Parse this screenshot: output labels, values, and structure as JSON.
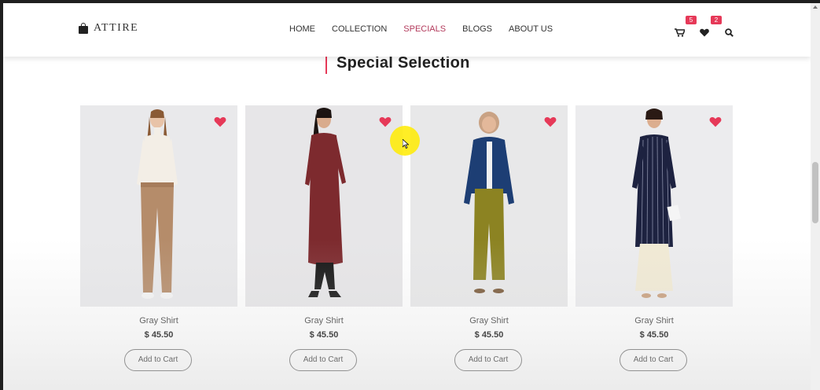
{
  "brand": {
    "name": "ATTIRE"
  },
  "nav": {
    "items": [
      {
        "label": "HOME"
      },
      {
        "label": "COLLECTION"
      },
      {
        "label": "SPECIALS",
        "active": true
      },
      {
        "label": "BLOGS"
      },
      {
        "label": "ABOUT US"
      }
    ]
  },
  "header_icons": {
    "cart_icon": "cart-icon",
    "cart_count": "5",
    "wishlist_icon": "heart-icon",
    "wishlist_count": "2",
    "search_icon": "search-icon"
  },
  "section": {
    "title": "Special Selection"
  },
  "colors": {
    "accent": "#e63958",
    "active_nav": "#b33a5c",
    "text": "#333333"
  },
  "products": [
    {
      "name": "Gray Shirt",
      "price": "$ 45.50",
      "button": "Add to Cart",
      "wishlist_icon": "heart-icon"
    },
    {
      "name": "Gray Shirt",
      "price": "$ 45.50",
      "button": "Add to Cart",
      "wishlist_icon": "heart-icon"
    },
    {
      "name": "Gray Shirt",
      "price": "$ 45.50",
      "button": "Add to Cart",
      "wishlist_icon": "heart-icon"
    },
    {
      "name": "Gray Shirt",
      "price": "$ 45.50",
      "button": "Add to Cart",
      "wishlist_icon": "heart-icon"
    }
  ]
}
